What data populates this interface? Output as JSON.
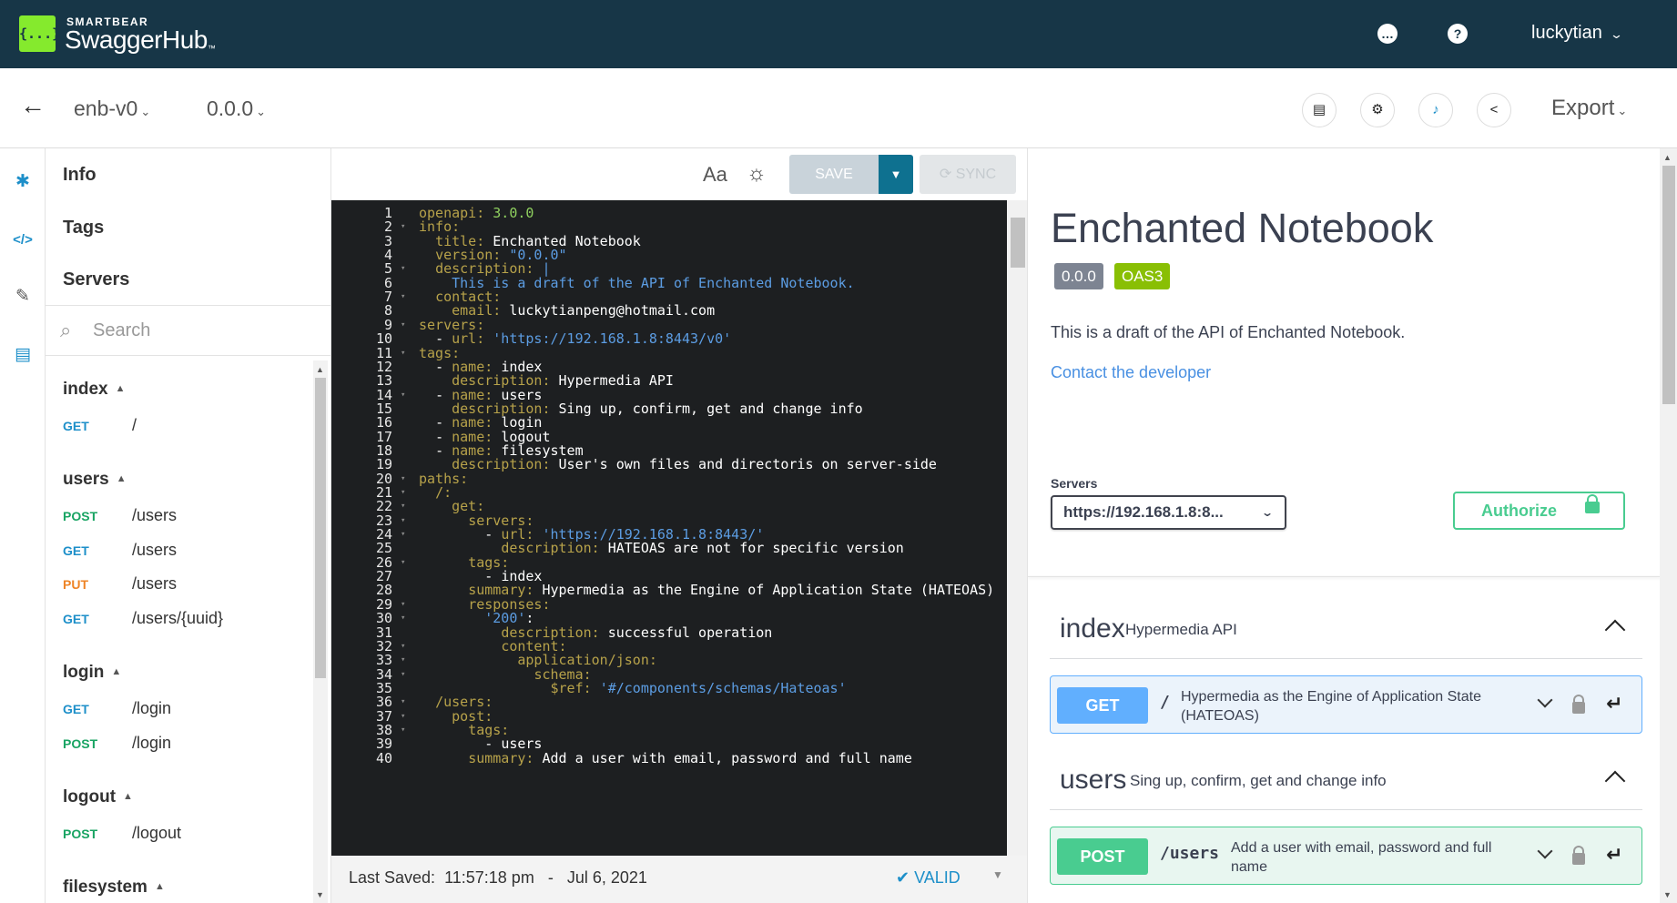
{
  "brand": {
    "small": "SMARTBEAR",
    "name": "SwaggerHub",
    "tm": "™",
    "logo": "{...}"
  },
  "header": {
    "user": "luckytian",
    "icons": [
      "chat-icon",
      "help-icon"
    ]
  },
  "subbar": {
    "back": "←",
    "api_name": "enb-v0",
    "api_version": "0.0.0",
    "export": "Export",
    "icons": [
      "document-icon",
      "settings-icon",
      "bell-icon",
      "share-icon"
    ]
  },
  "nav": {
    "top_items": [
      "Info",
      "Tags",
      "Servers"
    ],
    "search_placeholder": "Search",
    "groups": [
      {
        "name": "index",
        "ops": [
          {
            "method": "GET",
            "path": "/"
          }
        ]
      },
      {
        "name": "users",
        "ops": [
          {
            "method": "POST",
            "path": "/users"
          },
          {
            "method": "GET",
            "path": "/users"
          },
          {
            "method": "PUT",
            "path": "/users"
          },
          {
            "method": "GET",
            "path": "/users/{uuid}"
          }
        ]
      },
      {
        "name": "login",
        "ops": [
          {
            "method": "GET",
            "path": "/login"
          },
          {
            "method": "POST",
            "path": "/login"
          }
        ]
      },
      {
        "name": "logout",
        "ops": [
          {
            "method": "POST",
            "path": "/logout"
          }
        ]
      },
      {
        "name": "filesystem",
        "ops": []
      }
    ]
  },
  "editor": {
    "font_toggle": "Aa",
    "save": "SAVE",
    "sync": "SYNC",
    "last_saved_label": "Last Saved:",
    "last_saved_time": "11:57:18 pm",
    "last_saved_sep": "-",
    "last_saved_date": "Jul 6, 2021",
    "valid": "VALID",
    "lines": [
      "openapi: 3.0.0",
      "info:",
      "  title: Enchanted Notebook",
      "  version: \"0.0.0\"",
      "  description: |",
      "    This is a draft of the API of Enchanted Notebook.",
      "  contact:",
      "    email: luckytianpeng@hotmail.com",
      "servers:",
      "  - url: 'https://192.168.1.8:8443/v0'",
      "tags:",
      "  - name: index",
      "    description: Hypermedia API",
      "  - name: users",
      "    description: Sing up, confirm, get and change info",
      "  - name: login",
      "  - name: logout",
      "  - name: filesystem",
      "    description: User's own files and directoris on server-side",
      "paths:",
      "  /:",
      "    get:",
      "      servers:",
      "        - url: 'https://192.168.1.8:8443/'",
      "          description: HATEOAS are not for specific version",
      "      tags:",
      "        - index",
      "      summary: Hypermedia as the Engine of Application State (HATEOAS)",
      "      responses:",
      "        '200':",
      "          description: successful operation",
      "          content:",
      "            application/json:",
      "              schema:",
      "                $ref: '#/components/schemas/Hateoas'",
      "  /users:",
      "    post:",
      "      tags:",
      "        - users",
      "      summary: Add a user with email, password and full name"
    ]
  },
  "doc": {
    "title": "Enchanted Notebook",
    "version_badge": "0.0.0",
    "oas_badge": "OAS3",
    "description": "This is a draft of the API of Enchanted Notebook.",
    "contact": "Contact the developer",
    "servers_label": "Servers",
    "server_selected": "https://192.168.1.8:8...",
    "authorize": "Authorize",
    "sections": [
      {
        "name": "index",
        "desc": "Hypermedia API",
        "op": {
          "method": "GET",
          "path": "/",
          "summary_1": "Hypermedia as the Engine of Application State",
          "summary_2": "(HATEOAS)"
        }
      },
      {
        "name": "users",
        "desc": "Sing up, confirm, get and change info",
        "op": {
          "method": "POST",
          "path": "/users",
          "summary_1": "Add a user with email, password and full",
          "summary_2": "name"
        }
      }
    ]
  },
  "colors": {
    "topbar": "#173647",
    "logo": "#85ea2d",
    "get": "#61affe",
    "post": "#49cc90",
    "put": "#ee8426",
    "accent": "#0e7190"
  }
}
